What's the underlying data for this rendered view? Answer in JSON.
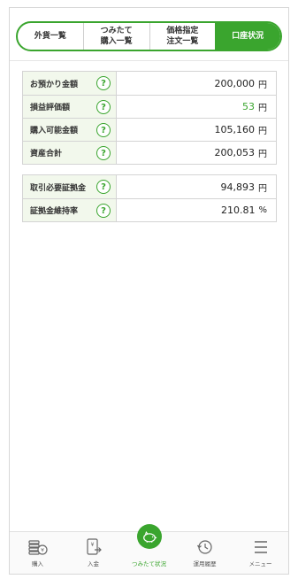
{
  "tabs": [
    {
      "line1": "外貨一覧",
      "line2": ""
    },
    {
      "line1": "つみたて",
      "line2": "購入一覧"
    },
    {
      "line1": "価格指定",
      "line2": "注文一覧"
    },
    {
      "line1": "口座状況",
      "line2": ""
    }
  ],
  "active_tab": 3,
  "account_table": {
    "rows": [
      {
        "label": "お預かり金額",
        "value": "200,000",
        "unit": "円"
      },
      {
        "label": "損益評価額",
        "value": "53",
        "unit": "円",
        "value_color": "#3aa52e"
      },
      {
        "label": "購入可能金額",
        "value": "105,160",
        "unit": "円"
      },
      {
        "label": "資産合計",
        "value": "200,053",
        "unit": "円"
      }
    ]
  },
  "margin_table": {
    "rows": [
      {
        "label": "取引必要証拠金",
        "value": "94,893",
        "unit": "円"
      },
      {
        "label": "証拠金維持率",
        "value": "210.81",
        "unit": "%"
      }
    ]
  },
  "help_glyph": "?",
  "bottom_nav": [
    {
      "label": "購入",
      "icon": "coins-yen-icon"
    },
    {
      "label": "入金",
      "icon": "deposit-icon"
    },
    {
      "label": "つみたて状況",
      "icon": "piggy-bank-icon"
    },
    {
      "label": "運用履歴",
      "icon": "history-clock-icon"
    },
    {
      "label": "メニュー",
      "icon": "hamburger-menu-icon"
    }
  ],
  "active_nav": 2,
  "colors": {
    "accent": "#3aa52e",
    "label_bg": "#f2f8ec",
    "border": "#d4d4d4"
  }
}
